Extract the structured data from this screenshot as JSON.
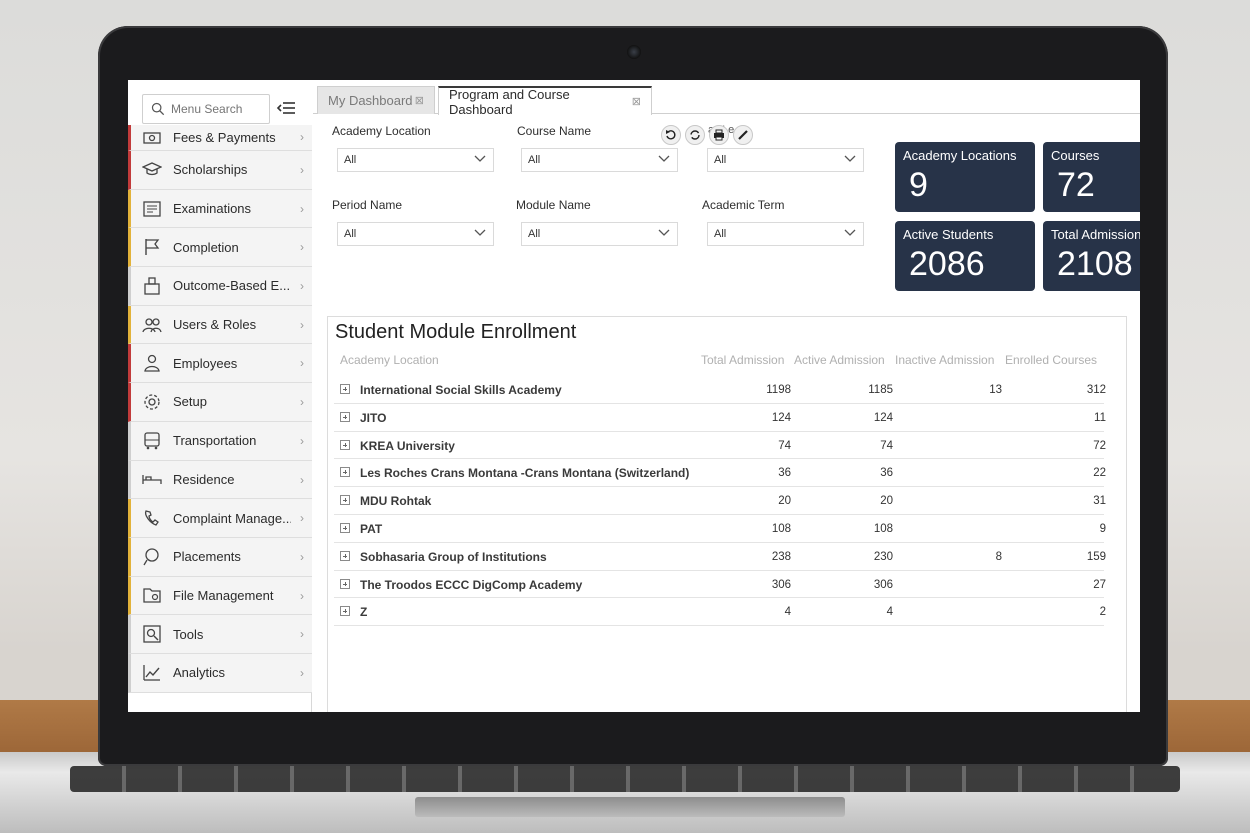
{
  "sidebar": {
    "search_placeholder": "Menu Search",
    "items": [
      {
        "label": "Fees & Payments",
        "icon": "payment-icon"
      },
      {
        "label": "Scholarships",
        "icon": "scholarship-icon"
      },
      {
        "label": "Examinations",
        "icon": "exam-icon"
      },
      {
        "label": "Completion",
        "icon": "flag-icon"
      },
      {
        "label": "Outcome-Based E...",
        "icon": "outcome-icon"
      },
      {
        "label": "Users & Roles",
        "icon": "users-icon"
      },
      {
        "label": "Employees",
        "icon": "employee-icon"
      },
      {
        "label": "Setup",
        "icon": "gear-icon"
      },
      {
        "label": "Transportation",
        "icon": "bus-icon"
      },
      {
        "label": "Residence",
        "icon": "bed-icon"
      },
      {
        "label": "Complaint Manage...",
        "icon": "complaint-icon"
      },
      {
        "label": "Placements",
        "icon": "placement-icon"
      },
      {
        "label": "File Management",
        "icon": "folder-gear-icon"
      },
      {
        "label": "Tools",
        "icon": "tools-icon"
      },
      {
        "label": "Analytics",
        "icon": "analytics-icon"
      }
    ]
  },
  "tabs": [
    {
      "label": "My Dashboard",
      "active": false
    },
    {
      "label": "Program and Course Dashboard",
      "active": true
    }
  ],
  "filters": {
    "row1": [
      {
        "label": "Academy Location",
        "value": "All"
      },
      {
        "label": "Course Name",
        "value": "All"
      },
      {
        "label": "",
        "value": "All"
      }
    ],
    "row1_partial_label": "a N e",
    "row2": [
      {
        "label": "Period Name",
        "value": "All"
      },
      {
        "label": "Module Name",
        "value": "All"
      },
      {
        "label": "Academic Term",
        "value": "All"
      }
    ]
  },
  "kpis": [
    {
      "label": "Academy Locations",
      "value": "9"
    },
    {
      "label": "Courses",
      "value": "72"
    },
    {
      "label": "Active Students",
      "value": "2086"
    },
    {
      "label": "Total Admission",
      "value": "2108"
    }
  ],
  "table": {
    "title": "Student Module Enrollment",
    "columns": [
      "Academy Location",
      "Total Admission",
      "Active Admission",
      "Inactive Admission",
      "Enrolled Courses"
    ],
    "rows": [
      {
        "name": "International Social Skills Academy",
        "total": "1198",
        "active": "1185",
        "inactive": "13",
        "courses": "312"
      },
      {
        "name": "JITO",
        "total": "124",
        "active": "124",
        "inactive": "",
        "courses": "11"
      },
      {
        "name": "KREA University",
        "total": "74",
        "active": "74",
        "inactive": "",
        "courses": "72"
      },
      {
        "name": "Les Roches Crans Montana -Crans Montana (Switzerland)",
        "total": "36",
        "active": "36",
        "inactive": "",
        "courses": "22"
      },
      {
        "name": "MDU Rohtak",
        "total": "20",
        "active": "20",
        "inactive": "",
        "courses": "31"
      },
      {
        "name": "PAT",
        "total": "108",
        "active": "108",
        "inactive": "",
        "courses": "9"
      },
      {
        "name": "Sobhasaria Group of Institutions",
        "total": "238",
        "active": "230",
        "inactive": "8",
        "courses": "159"
      },
      {
        "name": "The Troodos ECCC DigComp Academy",
        "total": "306",
        "active": "306",
        "inactive": "",
        "courses": "27"
      },
      {
        "name": "Z",
        "total": "4",
        "active": "4",
        "inactive": "",
        "courses": "2"
      }
    ]
  },
  "colors": {
    "kpi_bg": "#273348",
    "sidebar_accent_red": "#c23b3b",
    "sidebar_accent_gold": "#e2b23a"
  }
}
